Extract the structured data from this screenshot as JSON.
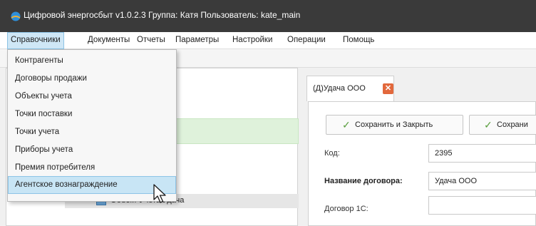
{
  "window": {
    "title": "Цифровой энергосбыт v1.0.2.3 Группа: Катя Пользователь: kate_main"
  },
  "menubar": [
    {
      "label": "Справочники",
      "active": true
    },
    {
      "label": "Документы"
    },
    {
      "label": "Отчеты"
    },
    {
      "label": "Параметры"
    },
    {
      "label": "Настройки"
    },
    {
      "label": "Операции"
    },
    {
      "label": "Помощь"
    }
  ],
  "dropdown": {
    "items": [
      {
        "label": "Контрагенты"
      },
      {
        "label": "Договоры продажи"
      },
      {
        "label": "Объекты учета"
      },
      {
        "label": "Точки поставки"
      },
      {
        "label": "Точки учета"
      },
      {
        "label": "Приборы учета"
      },
      {
        "label": "Премия потребителя"
      },
      {
        "label": "Агентское вознаграждение",
        "hovered": true
      }
    ]
  },
  "tree": {
    "row_label": "Объект Учета Удача"
  },
  "document": {
    "tab_label": "(Д)Удача ООО",
    "buttons": {
      "save_close": "Сохранить и Закрыть",
      "save": "Сохрани"
    },
    "fields": {
      "code_label": "Код:",
      "code_value": "2395",
      "contract_name_label": "Название договора:",
      "contract_name_value": "Удача ООО",
      "contract_1c_label": "Договор 1С:",
      "contract_1c_value": ""
    }
  },
  "colors": {
    "titlebar": "#3a3a3a",
    "menu_active": "#cfe7f6",
    "hover": "#c8e5f5",
    "selection_green": "#dff2db",
    "close_orange": "#e2683c",
    "check_green": "#5a9e3e"
  },
  "icons": {
    "app": "app-logo-icon",
    "tree_node": "object-folder-icon",
    "close_tab": "close-tab-icon",
    "check": "checkmark-icon",
    "expand": "chevron-right-icon",
    "cursor": "mouse-pointer-icon"
  }
}
